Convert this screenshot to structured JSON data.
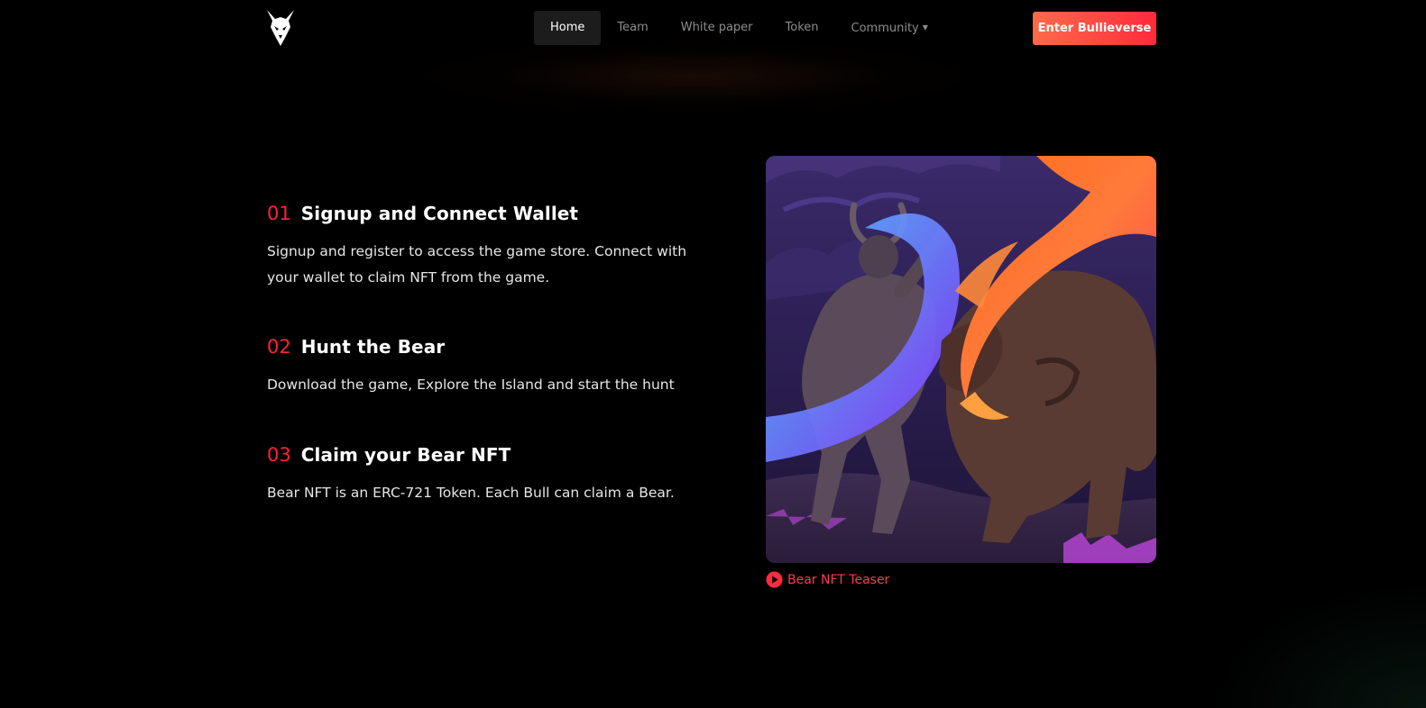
{
  "nav": {
    "logo": "bull-logo-icon",
    "items": [
      {
        "label": "Home",
        "active": true
      },
      {
        "label": "Team"
      },
      {
        "label": "White paper"
      },
      {
        "label": "Token"
      },
      {
        "label": "Community",
        "dropdown": true
      }
    ],
    "cta_label": "Enter Bullieverse"
  },
  "steps": [
    {
      "number": "01",
      "title": "Signup and Connect Wallet",
      "description": "Signup and register to access the game store. Connect with your wallet to claim NFT from the game."
    },
    {
      "number": "02",
      "title": "Hunt the Bear",
      "description": "Download the game, Explore the Island and start the hunt"
    },
    {
      "number": "03",
      "title": "Claim your Bear NFT",
      "description": "Bear NFT is an ERC-721 Token. Each Bull can claim a Bear."
    }
  ],
  "media": {
    "image": "bull-vs-bear-artwork",
    "teaser_label": "Bear NFT Teaser",
    "teaser_icon": "play-icon"
  },
  "colors": {
    "accent": "#ff2238",
    "cta_start": "#ff6a4a",
    "cta_end": "#ff2a3d",
    "background": "#000000"
  }
}
